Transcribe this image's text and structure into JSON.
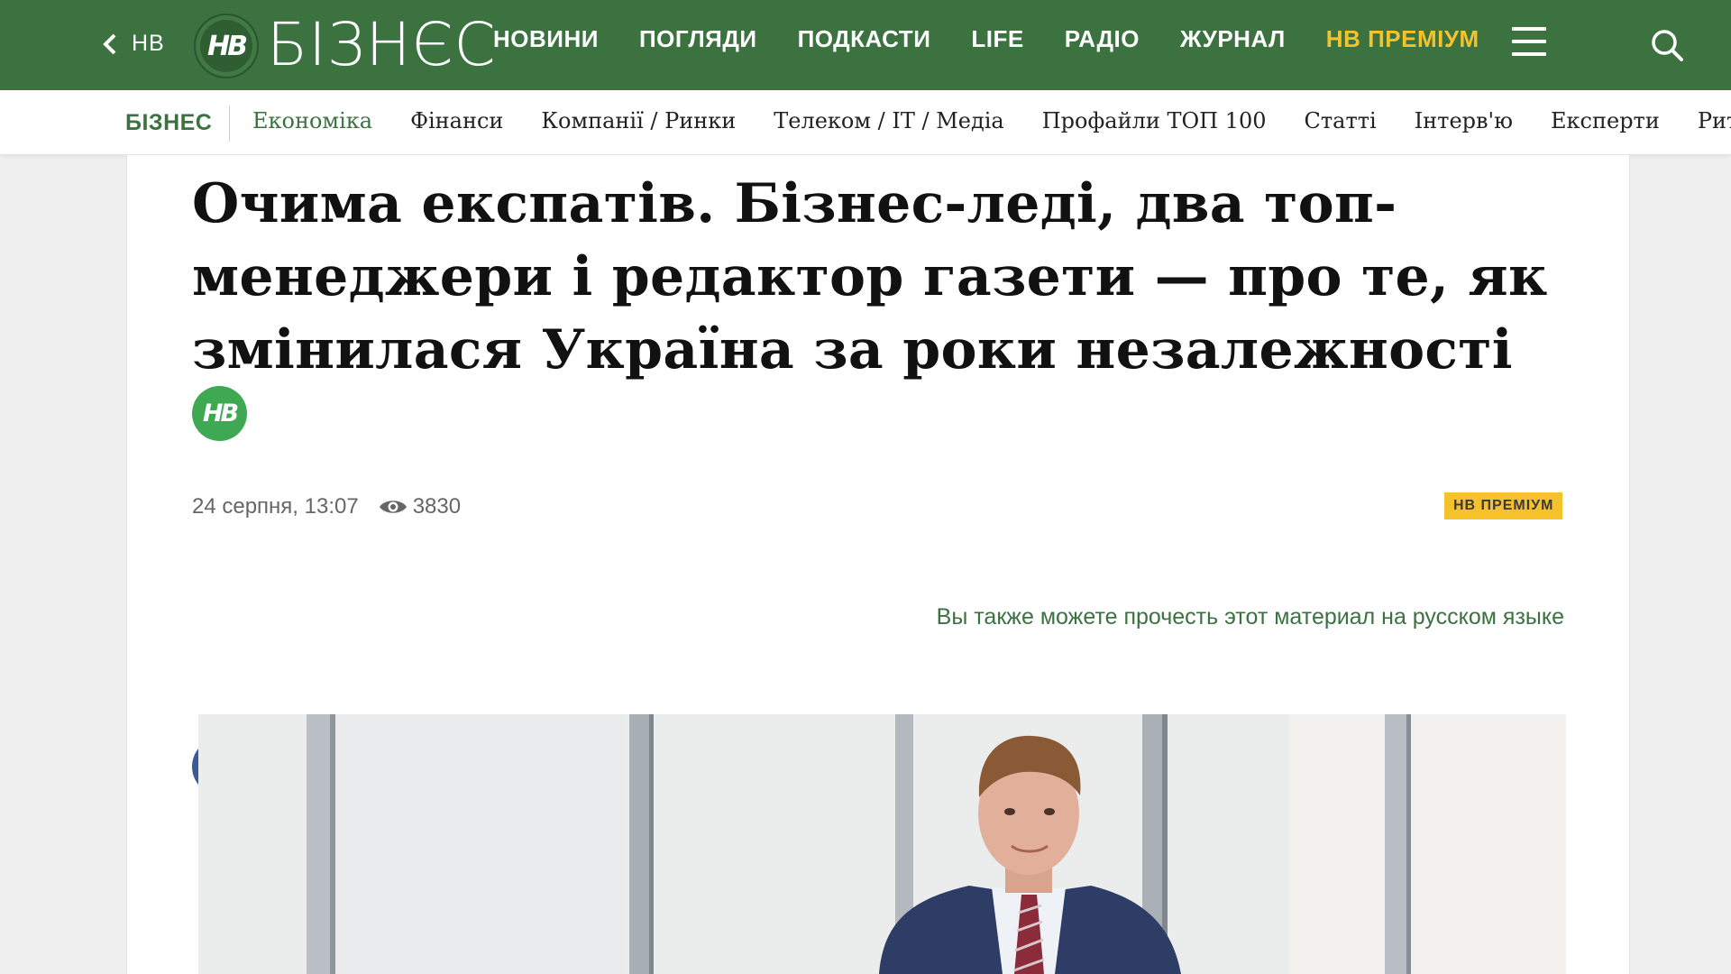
{
  "header": {
    "back_label": "НВ",
    "logo_mark": "НВ",
    "logo_text": "БІЗНЄС",
    "nav": [
      "НОВИНИ",
      "ПОГЛЯДИ",
      "ПОДКАСТИ",
      "LIFE",
      "РАДІО",
      "ЖУРНАЛ"
    ],
    "premium_label": "НВ ПРЕМІУМ",
    "icons": [
      "chevron-left-icon",
      "menu-icon",
      "search-icon"
    ]
  },
  "subnav": {
    "section": "БІЗНЕС",
    "items": [
      "Економіка",
      "Фінанси",
      "Компанії / Ринки",
      "Телеком / IT / Медіа",
      "Профайли ТОП 100",
      "Статті",
      "Інтерв'ю",
      "Експерти",
      "Рите"
    ],
    "active_index": 0
  },
  "article": {
    "title": "Очима експатів. Бізнес-леді, два топ-менеджери і редактор газети — про те, як змінилася Україна за роки незалежності",
    "badge_mark": "НВ",
    "date": "24 серпня, 13:07",
    "views": "3830",
    "premium_badge": "НВ ПРЕМІУМ",
    "share_icons": [
      "facebook-icon",
      "twitter-icon",
      "telegram-icon",
      "email-icon"
    ],
    "ru_link": "Вы также можете прочесть этот материал на русском языке"
  },
  "colors": {
    "brand_green": "#3b7240",
    "premium_yellow": "#f6c22c",
    "facebook": "#3b5998",
    "twitter": "#55acee",
    "telegram": "#2ca5e0",
    "email": "#c0393b"
  }
}
